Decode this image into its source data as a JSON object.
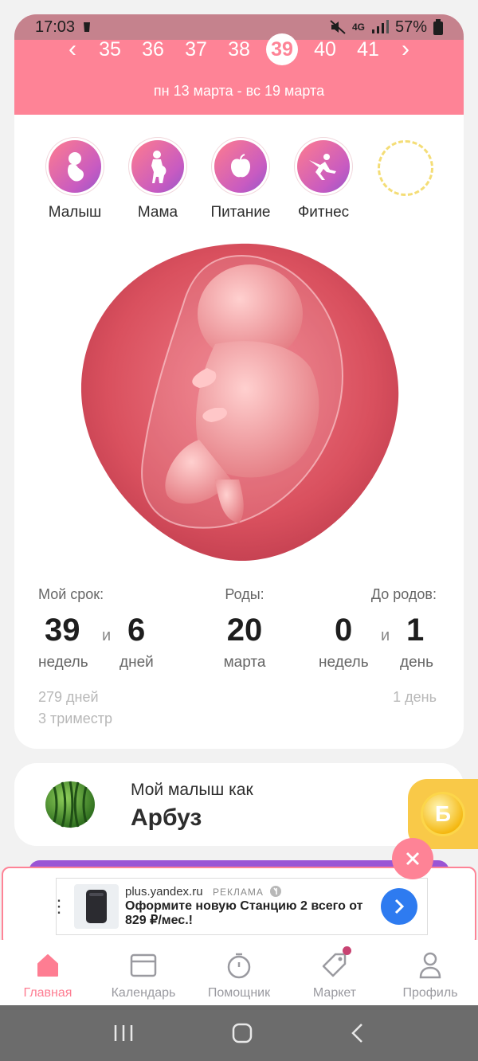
{
  "status": {
    "time": "17:03",
    "network": "4G",
    "battery": "57%"
  },
  "weeks": {
    "items": [
      "35",
      "36",
      "37",
      "38",
      "39",
      "40",
      "41"
    ],
    "active": "39",
    "range": "пн 13 марта - вс 19 марта"
  },
  "categories": [
    {
      "label": "Малыш",
      "icon": "fetus-icon"
    },
    {
      "label": "Мама",
      "icon": "pregnant-woman-icon"
    },
    {
      "label": "Питание",
      "icon": "apple-icon"
    },
    {
      "label": "Фитнес",
      "icon": "fitness-icon"
    }
  ],
  "stats": {
    "term_label": "Мой срок:",
    "term_weeks": "39",
    "term_and": "и",
    "term_days": "6",
    "term_weeks_unit": "недель",
    "term_days_unit": "дней",
    "term_total_days": "279 дней",
    "trimester": "3 триместр",
    "birth_label": "Роды:",
    "birth_day": "20",
    "birth_month": "марта",
    "left_label": "До родов:",
    "left_weeks": "0",
    "left_and": "и",
    "left_days": "1",
    "left_weeks_unit": "недель",
    "left_days_unit": "день",
    "left_total": "1 день"
  },
  "fruit": {
    "subtitle": "Мой малыш как",
    "name": "Арбуз"
  },
  "ad": {
    "domain": "plus.yandex.ru",
    "tag": "РЕКЛАМА",
    "title": "Оформите новую Станцию 2 всего от 829 ₽/мес.!"
  },
  "nav": [
    {
      "label": "Главная",
      "icon": "home-icon",
      "active": true
    },
    {
      "label": "Календарь",
      "icon": "calendar-icon"
    },
    {
      "label": "Помощник",
      "icon": "timer-icon"
    },
    {
      "label": "Маркет",
      "icon": "tag-icon"
    },
    {
      "label": "Профиль",
      "icon": "profile-icon"
    }
  ],
  "colors": {
    "accent": "#fe8396",
    "purple": "#9a55d5",
    "ad_button": "#2e7bf0",
    "coin": "#f9c948"
  }
}
